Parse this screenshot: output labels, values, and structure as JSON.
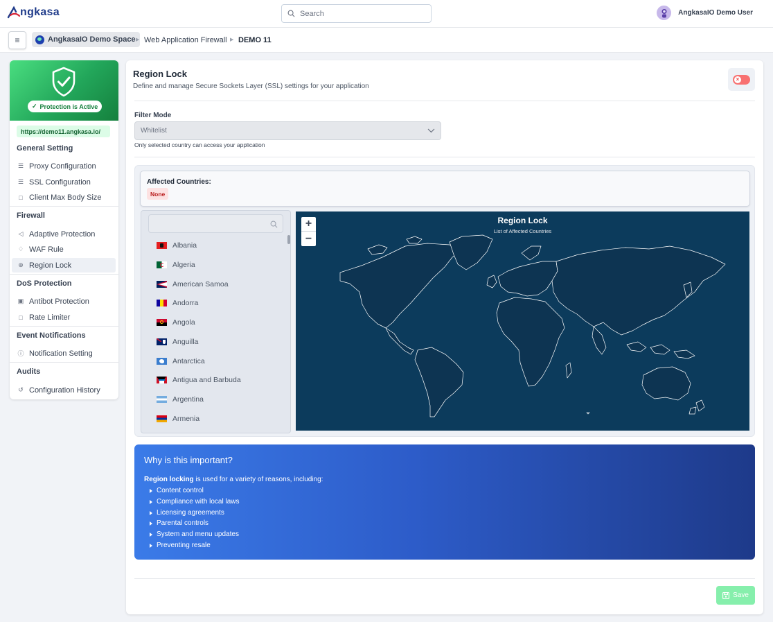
{
  "brand": {
    "name": "ngkasa",
    "accent": "#1f3b8a",
    "logo_red": "#d72638"
  },
  "search": {
    "placeholder": "Search"
  },
  "user": {
    "name": "AngkasaIO Demo User"
  },
  "breadcrumb": {
    "space": "AngkasaIO Demo Space",
    "section": "Web Application Firewall",
    "current": "DEMO 11"
  },
  "sidebar": {
    "status": "Protection is Active",
    "url": "https://demo11.angkasa.io/",
    "sections": [
      {
        "title": "General Setting",
        "items": [
          {
            "label": "Proxy Configuration",
            "icon": "list-icon"
          },
          {
            "label": "SSL Configuration",
            "icon": "list-icon"
          },
          {
            "label": "Client Max Body Size",
            "icon": "document-icon"
          }
        ]
      },
      {
        "title": "Firewall",
        "items": [
          {
            "label": "Adaptive Protection",
            "icon": "adaptive-icon"
          },
          {
            "label": "WAF Rule",
            "icon": "shield-icon"
          },
          {
            "label": "Region Lock",
            "icon": "globe-icon",
            "active": true
          }
        ]
      },
      {
        "title": "DoS Protection",
        "items": [
          {
            "label": "Antibot Protection",
            "icon": "bot-icon"
          },
          {
            "label": "Rate Limiter",
            "icon": "document-icon"
          }
        ]
      },
      {
        "title": "Event Notifications",
        "items": [
          {
            "label": "Notification Setting",
            "icon": "info-icon"
          }
        ]
      },
      {
        "title": "Audits",
        "items": [
          {
            "label": "Configuration History",
            "icon": "history-icon"
          }
        ]
      }
    ]
  },
  "page": {
    "title": "Region Lock",
    "subtitle": "Define and manage Secure Sockets Layer (SSL) settings for your application",
    "toggle_on": false
  },
  "filter": {
    "label": "Filter Mode",
    "value": "Whitelist",
    "help": "Only selected country can access your application"
  },
  "affected": {
    "title": "Affected Countries:",
    "value": "None"
  },
  "countries": [
    {
      "name": "Albania",
      "flag": "albania-flag"
    },
    {
      "name": "Algeria",
      "flag": "algeria-flag"
    },
    {
      "name": "American Samoa",
      "flag": "american-samoa-flag"
    },
    {
      "name": "Andorra",
      "flag": "andorra-flag"
    },
    {
      "name": "Angola",
      "flag": "angola-flag"
    },
    {
      "name": "Anguilla",
      "flag": "anguilla-flag"
    },
    {
      "name": "Antarctica",
      "flag": "antarctica-flag"
    },
    {
      "name": "Antigua and Barbuda",
      "flag": "antigua-flag"
    },
    {
      "name": "Argentina",
      "flag": "argentina-flag"
    },
    {
      "name": "Armenia",
      "flag": "armenia-flag"
    }
  ],
  "map": {
    "title": "Region Lock",
    "subtitle": "List of Affected Countries",
    "zoom_in": "+",
    "zoom_out": "−",
    "ocean_color": "#0c3b5c",
    "land_color": "#0d3452"
  },
  "why": {
    "title": "Why is this important?",
    "intro_bold": "Region locking",
    "intro_rest": " is used for a variety of reasons, including:",
    "items": [
      "Content control",
      "Compliance with local laws",
      "Licensing agreements",
      "Parental controls",
      "System and menu updates",
      "Preventing resale"
    ]
  },
  "actions": {
    "save": "Save"
  }
}
